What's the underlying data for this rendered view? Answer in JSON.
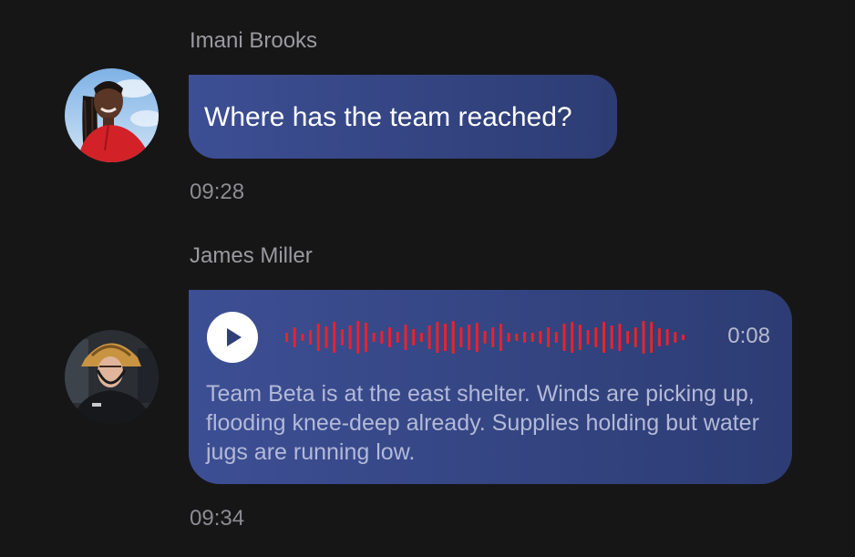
{
  "messages": [
    {
      "sender": "Imani Brooks",
      "text": "Where has the team reached?",
      "time": "09:28",
      "avatar_icon": "woman-portrait"
    },
    {
      "sender": "James Miller",
      "voice_note": {
        "duration": "0:08",
        "transcript": "Team Beta is at the east shelter. Winds are picking up, flooding knee-deep already. Supplies holding but water jugs are running low.",
        "waveform_color": "#e8232d"
      },
      "time": "09:34",
      "avatar_icon": "firefighter-portrait"
    }
  ],
  "colors": {
    "background": "#161617",
    "bubble_start": "#3d4f94",
    "bubble_end": "#2d3c73",
    "meta_text": "#9a9aa0"
  }
}
